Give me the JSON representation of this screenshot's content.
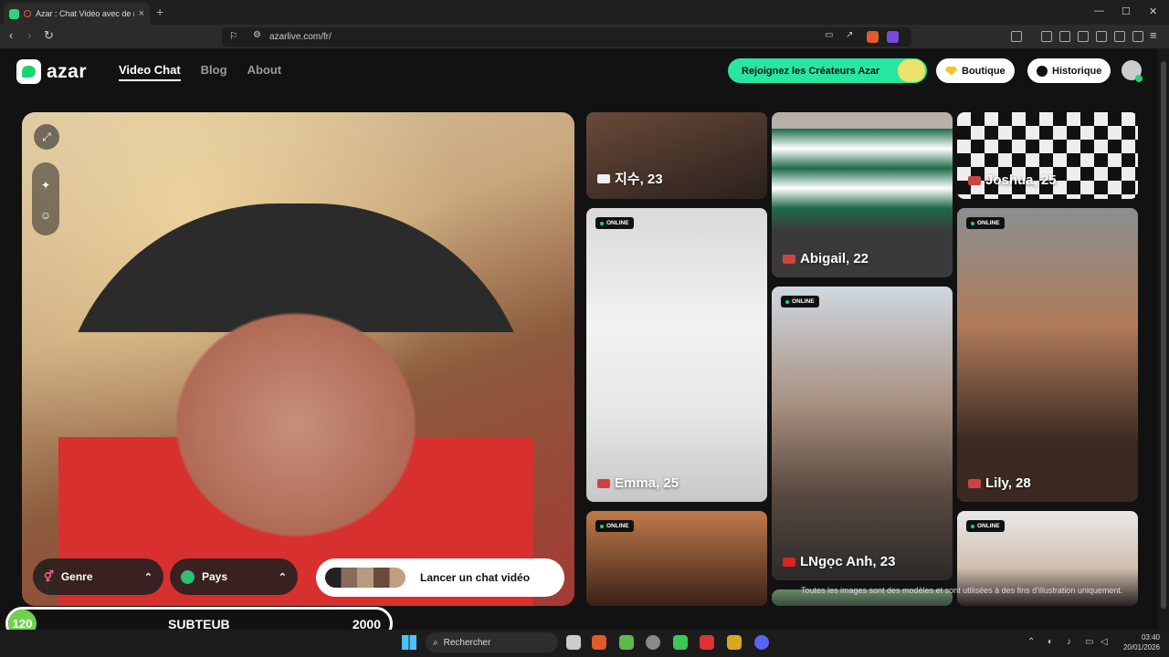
{
  "browser": {
    "tab_title": "Azar : Chat Vidéo avec de no",
    "tab_close": "×",
    "new_tab": "+",
    "url": "azarlive.com/fr/",
    "window_controls": [
      "—",
      "☐",
      "✕"
    ]
  },
  "header": {
    "logo_text": "azar",
    "nav": [
      "Video Chat",
      "Blog",
      "About"
    ],
    "creators_label": "Rejoignez les Créateurs Azar",
    "boutique_label": "Boutique",
    "historique_label": "Historique"
  },
  "video": {
    "genre_label": "Genre",
    "pays_label": "Pays",
    "launch_label": "Lancer un chat vidéo"
  },
  "cards": [
    {
      "name": "지수, 23",
      "online": false
    },
    {
      "name": "Abigail, 22",
      "online": false
    },
    {
      "name": "Joshua, 25",
      "online": false
    },
    {
      "name": "Emma, 25",
      "online": true
    },
    {
      "name": "Lily, 28",
      "online": true
    },
    {
      "name": "LNgọc Anh, 23",
      "online": true
    },
    {
      "name": "",
      "online": true
    },
    {
      "name": "",
      "online": true
    }
  ],
  "online_label": "ONLINE",
  "disclaimer": "Toutes les images sont des modèles et sont utilisées à des fins d'illustration uniquement.",
  "overlay": {
    "left_value": "120",
    "name": "SUBTEUB",
    "right_value": "2000"
  },
  "taskbar": {
    "search_placeholder": "Rechercher",
    "time": "03:40",
    "date": "20/01/2026"
  },
  "colors": {
    "brand_green": "#1bd46f",
    "creators_bg": "#26e6a0",
    "page_bg": "#121212"
  }
}
